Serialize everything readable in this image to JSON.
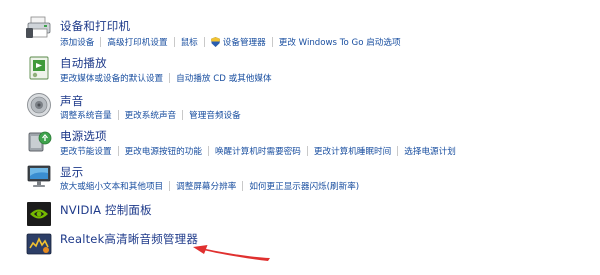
{
  "categories": [
    {
      "id": "devices",
      "title": "设备和打印机",
      "icon": "printer-icon",
      "links": [
        "添加设备",
        "高级打印机设置",
        "鼠标",
        "设备管理器",
        "更改 Windows To Go 启动选项"
      ]
    },
    {
      "id": "autoplay",
      "title": "自动播放",
      "icon": "autoplay-icon",
      "links": [
        "更改媒体或设备的默认设置",
        "自动播放 CD 或其他媒体"
      ]
    },
    {
      "id": "sound",
      "title": "声音",
      "icon": "speaker-icon",
      "links": [
        "调整系统音量",
        "更改系统声音",
        "管理音频设备"
      ]
    },
    {
      "id": "power",
      "title": "电源选项",
      "icon": "power-icon",
      "links": [
        "更改节能设置",
        "更改电源按钮的功能",
        "唤醒计算机时需要密码",
        "更改计算机睡眠时间",
        "选择电源计划"
      ]
    },
    {
      "id": "display",
      "title": "显示",
      "icon": "monitor-icon",
      "links": [
        "放大或缩小文本和其他项目",
        "调整屏幕分辨率",
        "如何更正显示器闪烁(刷新率)"
      ]
    },
    {
      "id": "nvidia",
      "title": "NVIDIA 控制面板",
      "icon": "nvidia-icon",
      "links": []
    },
    {
      "id": "realtek",
      "title": "Realtek高清晰音频管理器",
      "icon": "realtek-icon",
      "links": []
    }
  ],
  "colors": {
    "title": "#1e3a8a",
    "link": "#1a4fa0",
    "arrow": "#e0302f"
  }
}
